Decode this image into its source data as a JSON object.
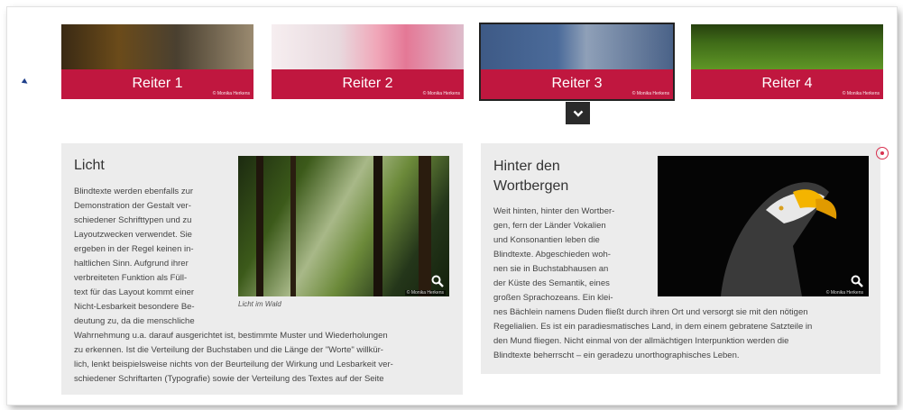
{
  "tabs": [
    {
      "label": "Reiter 1",
      "credit": "© Monika Herkens"
    },
    {
      "label": "Reiter 2",
      "credit": "© Monika Herkens"
    },
    {
      "label": "Reiter 3",
      "credit": "© Monika Herkens"
    },
    {
      "label": "Reiter 4",
      "credit": "© Monika Herkens"
    }
  ],
  "active_tab": "Reiter 3",
  "panel_left": {
    "title": "Licht",
    "image_caption": "Licht im Wald",
    "image_credit": "© Monika Herkens",
    "lines_narrow": [
      "Blindtexte werden ebenfalls zur",
      "Demonstration der Gestalt ver-",
      "schiedener Schrifttypen und zu",
      "Layoutzwecken verwendet. Sie",
      "ergeben in der Regel keinen in-",
      "haltlichen Sinn. Aufgrund ihrer",
      "verbreiteten Funktion als Füll-",
      "text für das Layout kommt einer",
      "Nicht-Lesbarkeit besondere Be-",
      "deutung zu, da die menschliche"
    ],
    "lines_wide": [
      "Wahrnehmung u.a. darauf ausgerichtet ist, bestimmte Muster und Wiederholungen",
      "zu erkennen. Ist die Verteilung der Buchstaben und die Länge der \"Worte\" willkür-",
      "lich, lenkt beispielsweise nichts von der Beurteilung der Wirkung und Lesbarkeit ver-",
      "schiedener Schriftarten (Typografie) sowie der Verteilung des Textes auf der Seite"
    ]
  },
  "panel_right": {
    "title_line1": "Hinter den",
    "title_line2": "Wortbergen",
    "image_credit": "© Monika Herkens",
    "lines_narrow": [
      "Weit hinten, hinter den Wortber-",
      "gen, fern der Länder Vokalien",
      "und Konsonantien leben die",
      "Blindtexte. Abgeschieden woh-",
      "nen sie in Buchstabhausen an",
      "der Küste des Semantik, eines",
      "großen Sprachozeans. Ein klei-"
    ],
    "lines_wide": [
      "nes Bächlein namens Duden fließt durch ihren Ort und versorgt sie mit den nötigen",
      "Regelialien. Es ist ein paradiesmatisches Land, in dem einem gebratene Satzteile in",
      "den Mund fliegen. Nicht einmal von der allmächtigen Interpunktion werden die",
      "Blindtexte beherrscht – ein geradezu unorthographisches Leben."
    ]
  },
  "icons": {
    "toggle": "chevron-down-icon",
    "zoom": "magnifier-icon",
    "close": "circle-close-icon",
    "cursor": "pointer-cursor-icon"
  },
  "colors": {
    "accent": "#c0173f",
    "panel_bg": "#ececec",
    "toggle_bg": "#2a2a2a"
  }
}
